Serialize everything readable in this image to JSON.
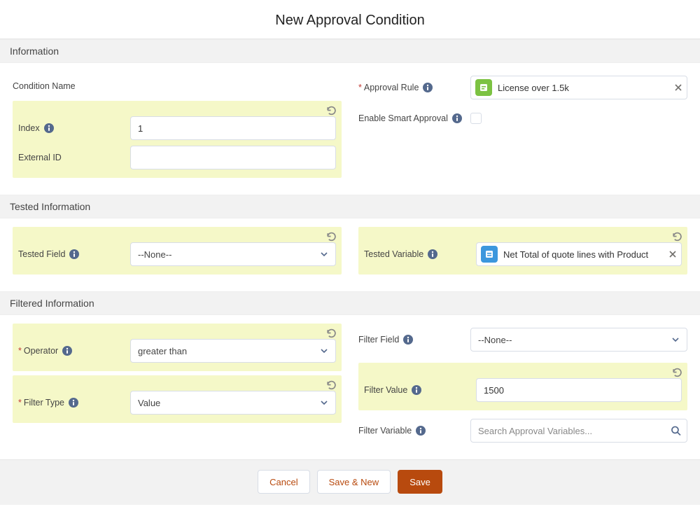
{
  "page_title": "New Approval Condition",
  "sections": {
    "information": {
      "header": "Information",
      "condition_name_label": "Condition Name",
      "condition_name_value": "",
      "index_label": "Index",
      "index_value": "1",
      "external_id_label": "External ID",
      "external_id_value": "",
      "approval_rule_label": "Approval Rule",
      "approval_rule_selected": "License over 1.5k",
      "enable_smart_label": "Enable Smart Approval"
    },
    "tested": {
      "header": "Tested Information",
      "tested_field_label": "Tested Field",
      "tested_field_selected": "--None--",
      "tested_variable_label": "Tested Variable",
      "tested_variable_selected": "Net Total of quote lines with Product"
    },
    "filtered": {
      "header": "Filtered Information",
      "operator_label": "Operator",
      "operator_selected": "greater than",
      "filter_type_label": "Filter Type",
      "filter_type_selected": "Value",
      "filter_field_label": "Filter Field",
      "filter_field_selected": "--None--",
      "filter_value_label": "Filter Value",
      "filter_value_value": "1500",
      "filter_variable_label": "Filter Variable",
      "filter_variable_placeholder": "Search Approval Variables..."
    }
  },
  "footer": {
    "cancel": "Cancel",
    "save_new": "Save & New",
    "save": "Save"
  }
}
